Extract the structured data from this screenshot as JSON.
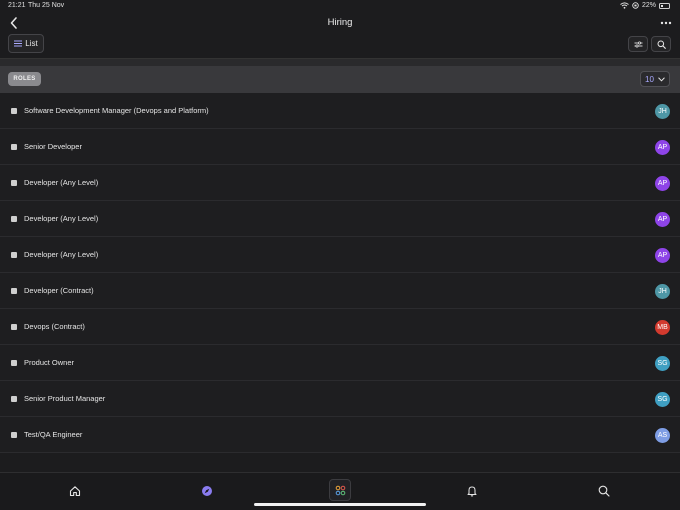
{
  "status": {
    "time": "21:21",
    "date": "Thu 25 Nov",
    "battery": "22%",
    "battery_level": 0.22
  },
  "header": {
    "title": "Hiring"
  },
  "toolbar": {
    "view_label": "List"
  },
  "section": {
    "badge": "ROLES",
    "page_size": "10"
  },
  "roles": [
    {
      "title": "Software Development Manager (Devops and Platform)",
      "assignee": "JH",
      "color": "#4e97a6"
    },
    {
      "title": "Senior Developer",
      "assignee": "AP",
      "color": "#8e44e8"
    },
    {
      "title": "Developer (Any Level)",
      "assignee": "AP",
      "color": "#8e44e8"
    },
    {
      "title": "Developer (Any Level)",
      "assignee": "AP",
      "color": "#8e44e8"
    },
    {
      "title": "Developer (Any Level)",
      "assignee": "AP",
      "color": "#8e44e8"
    },
    {
      "title": "Developer (Contract)",
      "assignee": "JH",
      "color": "#4e97a6"
    },
    {
      "title": "Devops (Contract)",
      "assignee": "MB",
      "color": "#d23a2e"
    },
    {
      "title": "Product Owner",
      "assignee": "SG",
      "color": "#3f9fc2"
    },
    {
      "title": "Senior Product Manager",
      "assignee": "SG",
      "color": "#3f9fc2"
    },
    {
      "title": "Test/QA Engineer",
      "assignee": "AS",
      "color": "#7e9de4"
    }
  ],
  "icons": {
    "back": "chevron-left-icon",
    "more": "ellipsis-icon",
    "list": "list-icon",
    "filter": "sliders-icon",
    "search": "magnifier-icon",
    "home": "home-icon",
    "explore": "compass-icon",
    "apps": "apps-grid-icon",
    "notifications": "bell-icon"
  },
  "colors": {
    "accent": "#8a7cf0",
    "background": "#1c1c1e"
  }
}
